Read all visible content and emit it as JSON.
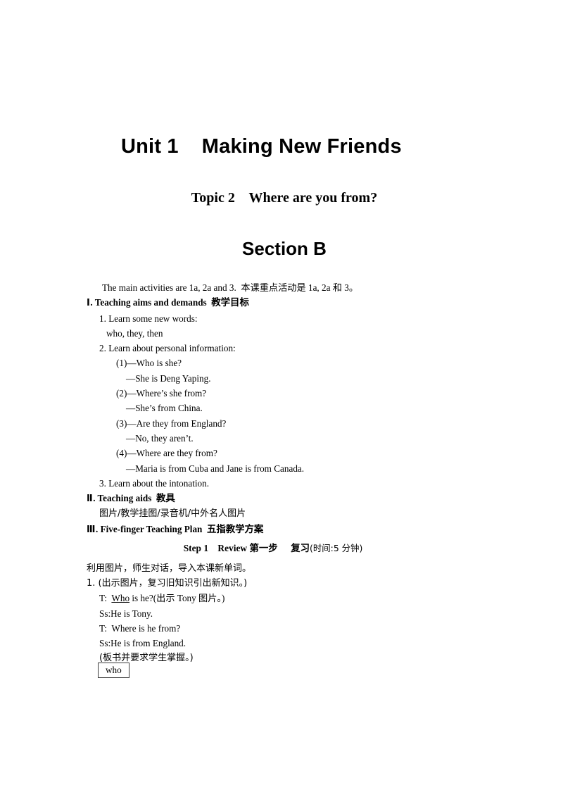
{
  "document": {
    "unit_title": "Unit 1    Making New Friends",
    "topic_title": "Topic 2    Where are you from?",
    "section_title": "Section B",
    "main_activities": "The main activities are 1a, 2a and 3.  本课重点活动是 1a, 2a 和 3。",
    "sections": [
      {
        "numeral": "Ⅰ",
        "heading_en": ". Teaching aims and demands  ",
        "heading_cn": "教学目标",
        "lines": [
          {
            "indent": "i1",
            "text": "1. Learn some new words:"
          },
          {
            "indent": "i2",
            "text": "who, they, then"
          },
          {
            "indent": "i1",
            "text": "2. Learn about personal information:"
          },
          {
            "indent": "i3",
            "text": "(1)—Who is she?"
          },
          {
            "indent": "i4",
            "text": "—She is Deng Yaping."
          },
          {
            "indent": "i3",
            "text": "(2)—Where’s she from?"
          },
          {
            "indent": "i4",
            "text": "—She’s from China."
          },
          {
            "indent": "i3",
            "text": "(3)—Are they from England?"
          },
          {
            "indent": "i4",
            "text": "—No, they aren’t."
          },
          {
            "indent": "i3",
            "text": "(4)—Where are they from?"
          },
          {
            "indent": "i4",
            "text": "—Maria is from Cuba and Jane is from Canada."
          },
          {
            "indent": "i1",
            "text": "3. Learn about the intonation."
          }
        ]
      },
      {
        "numeral": "Ⅱ",
        "heading_en": ". Teaching aids  ",
        "heading_cn": "教具",
        "lines": [
          {
            "indent": "i1",
            "text": "图片/教学挂图/录音机/中外名人图片",
            "cn": true
          }
        ]
      },
      {
        "numeral": "Ⅲ",
        "heading_en": ". Five-finger Teaching Plan  ",
        "heading_cn": "五指教学方案",
        "lines": []
      }
    ],
    "step": {
      "label_en": "Step 1    Review ",
      "label_cn": "第一步    复习",
      "time": "(时间:5 分钟)"
    },
    "lower_lines": [
      {
        "indent": "",
        "text": "利用图片，师生对话，导入本课新单词。",
        "cn": true
      },
      {
        "indent": "",
        "text": "1. (出示图片，复习旧知识引出新知识。)",
        "cn": true
      },
      {
        "indent": "i1",
        "segments": [
          {
            "text": "T:  "
          },
          {
            "text": "Who",
            "underline": true
          },
          {
            "text": " is he?(出示 Tony 图片。)"
          }
        ]
      },
      {
        "indent": "i1",
        "text": "Ss:He is Tony."
      },
      {
        "indent": "i1",
        "text": "T:  Where is he from?"
      },
      {
        "indent": "i1",
        "text": "Ss:He is from England."
      },
      {
        "indent": "i1",
        "text": "(板书并要求学生掌握。)",
        "cn": true
      }
    ],
    "word_box": {
      "label": "who"
    }
  }
}
